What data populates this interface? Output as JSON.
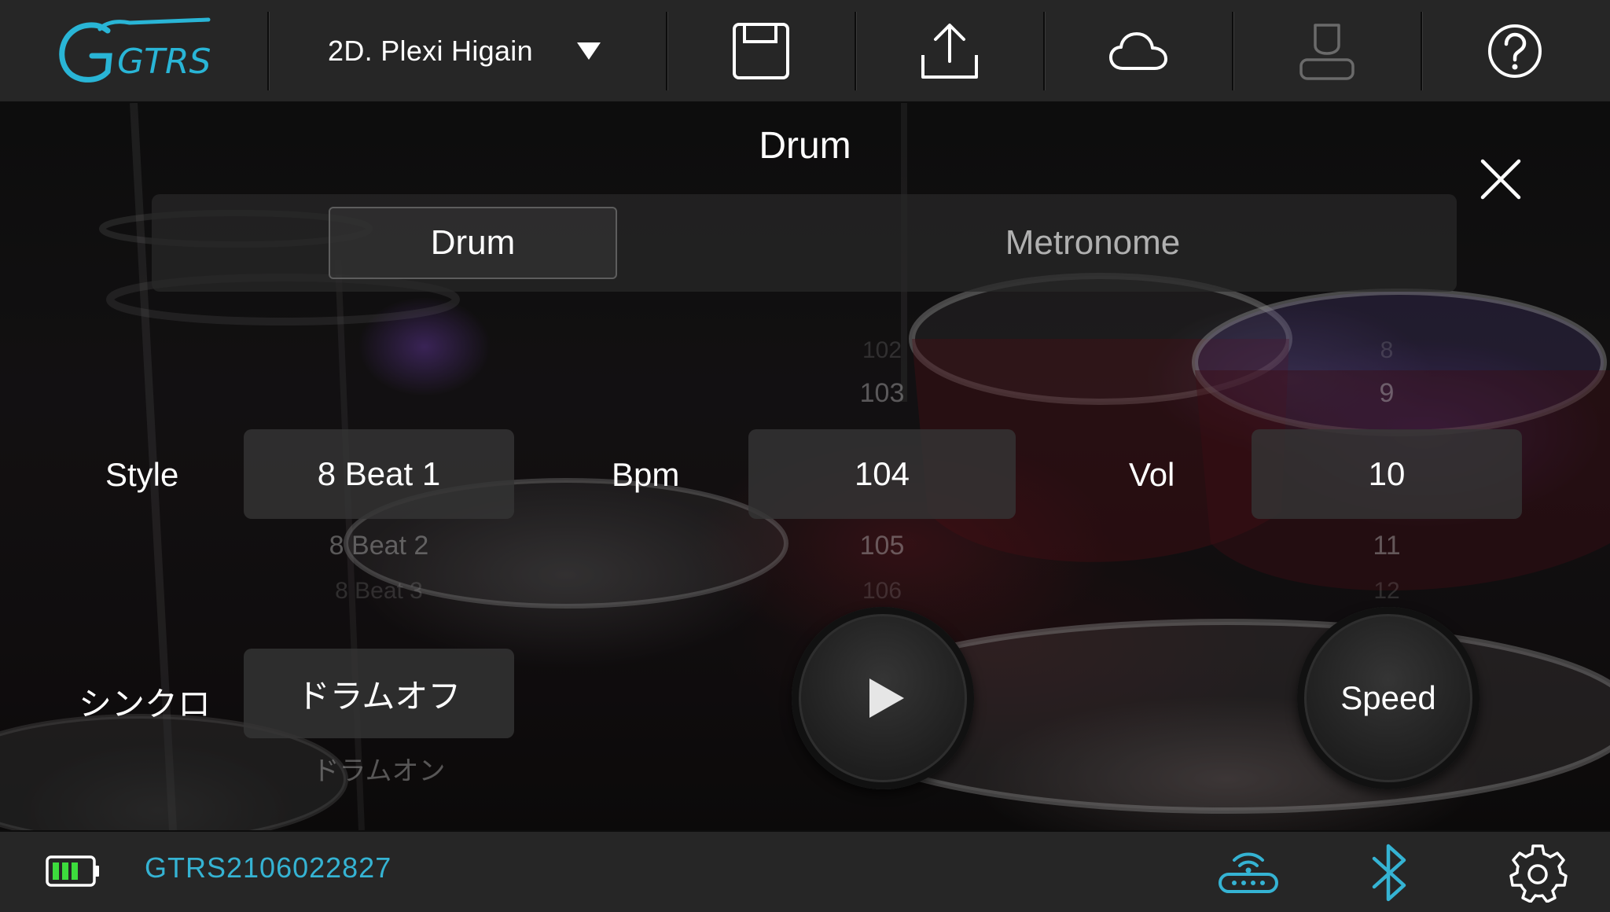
{
  "app": {
    "logo_text": "GTRS"
  },
  "header": {
    "preset_name": "2D. Plexi Higain",
    "icons": [
      "save-icon",
      "upload-icon",
      "cloud-icon",
      "user-icon",
      "help-icon"
    ]
  },
  "panel": {
    "title": "Drum",
    "tabs": [
      {
        "label": "Drum",
        "active": true
      },
      {
        "label": "Metronome",
        "active": false
      }
    ]
  },
  "style": {
    "label": "Style",
    "value": "8 Beat 1",
    "next": "8 Beat 2",
    "next2": "8 Beat 3"
  },
  "bpm": {
    "label": "Bpm",
    "prev2": "102",
    "prev": "103",
    "value": "104",
    "next": "105",
    "next2": "106"
  },
  "vol": {
    "label": "Vol",
    "prev2": "8",
    "prev": "9",
    "value": "10",
    "next": "11",
    "next2": "12"
  },
  "sync": {
    "label": "シンクロ",
    "value": "ドラムオフ",
    "next": "ドラムオン"
  },
  "controls": {
    "speed_label": "Speed"
  },
  "status": {
    "device_id": "GTRS2106022827",
    "battery_level": 1.0,
    "colors": {
      "accent": "#35b3d3",
      "battery": "#3ddc3d"
    }
  }
}
